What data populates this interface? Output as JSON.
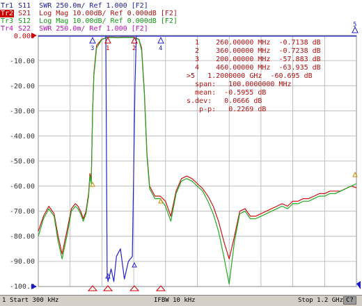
{
  "traces": [
    {
      "name": "Tr1",
      "text": " S11  SWR 250.0m/ Ref 1.000 [F2]",
      "color": "#1a1a99"
    },
    {
      "name": "Tr2",
      "text": " S21  Log Mag 10.00dB/ Ref 0.000dB [F2]",
      "color": "#b01010",
      "active": true
    },
    {
      "name": "Tr3",
      "text": " S12  Log Mag 10.00dB/ Ref 0.000dB [F2]",
      "color": "#119911"
    },
    {
      "name": "Tr4",
      "text": " S22  SWR 250.0m/ Ref 1.000 [F2]",
      "color": "#bb11bb"
    }
  ],
  "y_axis": {
    "labels": [
      "0.000",
      "-10.00",
      "-20.00",
      "-30.00",
      "-40.00",
      "-50.00",
      "-60.00",
      "-70.00",
      "-80.00",
      "-90.00",
      "-100.0"
    ],
    "min": -100,
    "max": 0
  },
  "markers": [
    {
      "id": "1",
      "text": "   1    260.00000 MHz  -0.7138 dB"
    },
    {
      "id": "2",
      "text": "   2    360.00000 MHz  -0.7238 dB"
    },
    {
      "id": "3",
      "text": "   3    200.00000 MHz  -57.883 dB"
    },
    {
      "id": "4",
      "text": "   4    460.00000 MHz  -63.935 dB"
    },
    {
      "id": "5",
      "text": " >5   1.2000000 GHz  -60.695 dB"
    }
  ],
  "stats": [
    {
      "text": "  span:   100.0000000 MHz"
    },
    {
      "text": "  mean:  -0.5955 dB"
    },
    {
      "text": "s.dev:   0.0666 dB"
    },
    {
      "text": "   p-p:   0.2269 dB"
    }
  ],
  "status": {
    "channel": "1",
    "start": "Start 300 kHz",
    "ifbw": "IFBW 10 kHz",
    "stop": "Stop 1.2 GHz",
    "cal": "C?"
  },
  "chart_data": {
    "type": "line",
    "xlim_mhz": [
      0.3,
      1200
    ],
    "ylim": [
      -100,
      0
    ],
    "ylabel": "",
    "series": [
      {
        "name": "S21",
        "color": "#cc1111",
        "x": [
          0.3,
          20,
          40,
          60,
          75,
          90,
          110,
          125,
          140,
          150,
          160,
          170,
          180,
          190,
          195,
          200,
          205,
          210,
          220,
          240,
          260,
          280,
          300,
          320,
          340,
          360,
          380,
          390,
          400,
          410,
          420,
          440,
          460,
          480,
          500,
          520,
          540,
          560,
          580,
          600,
          620,
          640,
          660,
          680,
          700,
          720,
          740,
          760,
          780,
          800,
          820,
          840,
          860,
          880,
          900,
          920,
          940,
          960,
          980,
          1000,
          1020,
          1040,
          1060,
          1080,
          1100,
          1120,
          1140,
          1160,
          1180,
          1200
        ],
        "y": [
          -78,
          -72,
          -68,
          -71,
          -80,
          -87,
          -77,
          -69,
          -67,
          -68,
          -70,
          -73,
          -70,
          -63,
          -55,
          -58,
          -30,
          -15,
          -4,
          -1.5,
          -0.7,
          -0.7,
          -0.8,
          -0.7,
          -0.7,
          -0.7,
          -1.5,
          -5,
          -22,
          -47,
          -60,
          -64,
          -64,
          -66,
          -72,
          -62,
          -57,
          -56,
          -57,
          -59,
          -61,
          -64,
          -68,
          -74,
          -82,
          -89,
          -80,
          -70,
          -69,
          -72,
          -72,
          -71,
          -70,
          -69,
          -68,
          -67,
          -68,
          -66,
          -66,
          -65,
          -65,
          -64,
          -63,
          -63,
          -62,
          -62,
          -62,
          -61,
          -60,
          -60.7
        ]
      },
      {
        "name": "S12",
        "color": "#22aa22",
        "x": [
          0.3,
          20,
          40,
          60,
          75,
          90,
          110,
          125,
          140,
          150,
          160,
          170,
          180,
          190,
          195,
          200,
          205,
          210,
          220,
          240,
          260,
          280,
          300,
          320,
          340,
          360,
          380,
          390,
          400,
          410,
          420,
          440,
          460,
          480,
          500,
          520,
          540,
          560,
          580,
          600,
          620,
          640,
          660,
          680,
          700,
          720,
          740,
          760,
          780,
          800,
          820,
          840,
          860,
          880,
          900,
          920,
          940,
          960,
          980,
          1000,
          1020,
          1040,
          1060,
          1080,
          1100,
          1120,
          1140,
          1160,
          1180,
          1200
        ],
        "y": [
          -80,
          -73,
          -69,
          -72,
          -82,
          -89,
          -79,
          -70,
          -68,
          -69,
          -71,
          -74,
          -71,
          -64,
          -56,
          -59,
          -31,
          -16,
          -5,
          -1.6,
          -0.8,
          -0.8,
          -0.9,
          -0.8,
          -0.8,
          -0.8,
          -1.6,
          -6,
          -23,
          -48,
          -61,
          -65,
          -65,
          -68,
          -74,
          -63,
          -58,
          -57,
          -58,
          -60,
          -62,
          -66,
          -71,
          -78,
          -88,
          -99,
          -82,
          -71,
          -70,
          -73,
          -73,
          -72,
          -71,
          -70,
          -69,
          -68,
          -69,
          -67,
          -67,
          -66,
          -66,
          -65,
          -64,
          -64,
          -63,
          -63,
          -62,
          -61,
          -60,
          -59
        ]
      },
      {
        "name": "S11",
        "color": "#2222cc",
        "x": [
          255,
          258,
          260,
          263,
          268,
          275,
          285,
          295,
          310,
          325,
          340,
          355,
          360,
          365,
          370
        ],
        "y": [
          0,
          -60,
          -95,
          -98,
          -96,
          -93,
          -98,
          -88,
          -85,
          -97,
          -90,
          -88,
          -55,
          -20,
          0
        ]
      }
    ]
  }
}
